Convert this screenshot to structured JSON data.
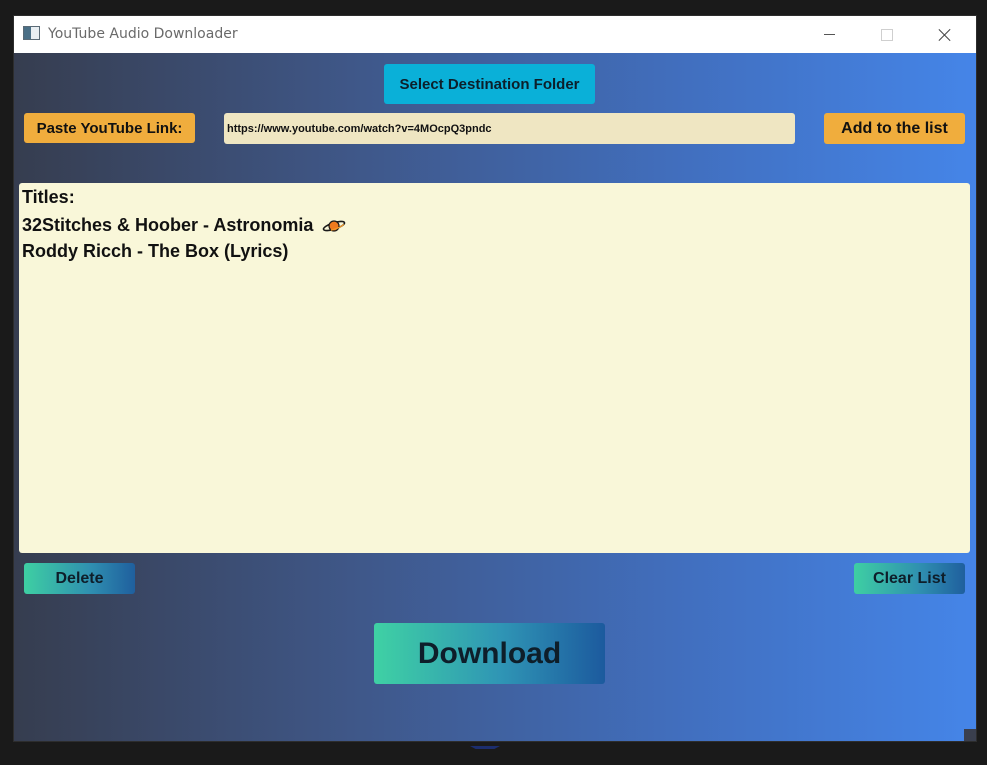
{
  "window": {
    "title": "YouTube Audio Downloader"
  },
  "toolbar": {
    "select_folder_label": "Select Destination Folder",
    "paste_link_label": "Paste YouTube Link:",
    "add_to_list_label": "Add to the list"
  },
  "url_input": {
    "value": "https://www.youtube.com/watch?v=4MOcpQ3pndc",
    "placeholder": ""
  },
  "titles_panel": {
    "heading": "Titles:",
    "items": [
      {
        "label": "32Stitches & Hoober - Astronomia",
        "icon": "planet-icon"
      },
      {
        "label": "Roddy Ricch - The Box (Lyrics)"
      }
    ]
  },
  "actions": {
    "delete_label": "Delete",
    "clear_label": "Clear List",
    "download_label": "Download"
  },
  "colors": {
    "cyan_button": "#0ab0d8",
    "orange_button": "#f0ad3d",
    "input_bg": "#efe6c2",
    "panel_bg": "#f9f7d9",
    "gradient_left": "#363d4f",
    "gradient_right": "#4585e8",
    "teal_button_left": "#3ecfa3",
    "teal_button_right": "#1f5f9e"
  }
}
